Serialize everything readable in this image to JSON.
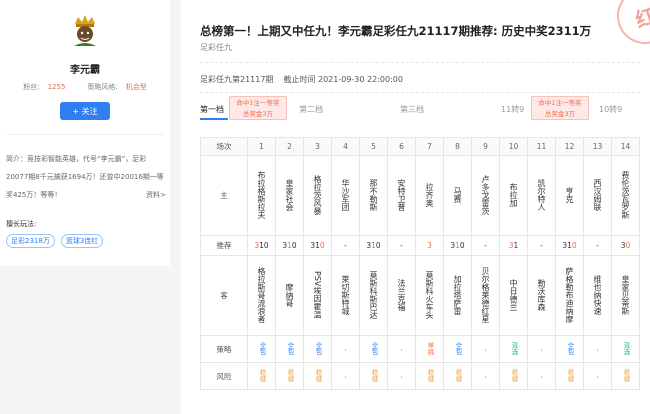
{
  "profile": {
    "name": "李元霸",
    "stats": [
      {
        "label": "粉丝:",
        "value": "1255"
      },
      {
        "label": "策略风格:",
        "value": "机会型"
      }
    ],
    "follow_label": "+ 关注",
    "intro": "简介：竞技彩智能英雄，代号“李元霸”，足彩20077期8千元擒获1694万！还曾中20016期一等奖425万！等等！",
    "more_label": "资料>",
    "good_at_label": "擅长玩法:",
    "tags": [
      "足彩2318万",
      "篮球3连红"
    ]
  },
  "article": {
    "title": "总榜第一！上期又中任九！李元霸足彩任九21117期推荐: 历史中奖2311万",
    "subtitle": "足彩任九",
    "stamp": "红",
    "period": "足彩任九第21117期",
    "deadline": "截止时间 2021-09-30 22:00:00"
  },
  "tiers": [
    {
      "label": "第一档"
    },
    {
      "label": "第二档"
    },
    {
      "label": "第三档"
    },
    {
      "label": "11转9"
    },
    {
      "label": "10转9"
    }
  ],
  "badges": [
    {
      "line1": "命中1注一等奖",
      "line2": "总奖金3万"
    },
    {
      "line1": "命中1注一等奖",
      "line2": "总奖金3万"
    }
  ],
  "table": {
    "row_labels": {
      "index": "场次",
      "home": "主",
      "rec": "推荐",
      "away": "客",
      "strategy": "策略",
      "risk": "风险"
    },
    "matches": [
      {
        "no": "1",
        "home": "布拉格斯拉夫",
        "rec": [
          "3",
          "1",
          "0"
        ],
        "hits": [
          true,
          false,
          false
        ],
        "away": "格拉斯哥流浪者",
        "strategy": "全包",
        "risk": "稳健"
      },
      {
        "no": "2",
        "home": "皇家社会",
        "rec": [
          "3",
          "1",
          "0"
        ],
        "hits": [
          false,
          true,
          false
        ],
        "away": "摩纳哥",
        "strategy": "全包",
        "risk": "稳健"
      },
      {
        "no": "3",
        "home": "格拉茨风暴",
        "rec": [
          "3",
          "1",
          "0"
        ],
        "hits": [
          false,
          false,
          true
        ],
        "away": "PSV埃因霍温",
        "strategy": "全包",
        "risk": "稳健"
      },
      {
        "no": "4",
        "home": "华沙军团",
        "rec": [
          "-"
        ],
        "hits": [
          false
        ],
        "away": "莱切斯特城",
        "strategy": "-",
        "risk": "-"
      },
      {
        "no": "5",
        "home": "那不勒斯",
        "rec": [
          "3",
          "1",
          "0"
        ],
        "hits": [
          false,
          true,
          false
        ],
        "away": "莫斯科斯巴达",
        "strategy": "全包",
        "risk": "稳健"
      },
      {
        "no": "6",
        "home": "安特卫普",
        "rec": [
          "-"
        ],
        "hits": [
          false
        ],
        "away": "法兰克福",
        "strategy": "-",
        "risk": "-"
      },
      {
        "no": "7",
        "home": "拉齐奥",
        "rec": [
          "3"
        ],
        "hits": [
          true
        ],
        "away": "莫斯科火车头",
        "strategy": "单挑",
        "risk": "稳健"
      },
      {
        "no": "8",
        "home": "马赛",
        "rec": [
          "3",
          "1",
          "0"
        ],
        "hits": [
          false,
          true,
          false
        ],
        "away": "加拉塔萨雷",
        "strategy": "全包",
        "risk": "稳健"
      },
      {
        "no": "9",
        "home": "卢多戈雷茨",
        "rec": [
          "-"
        ],
        "hits": [
          false
        ],
        "away": "贝尔格莱德红星",
        "strategy": "-",
        "risk": "-"
      },
      {
        "no": "10",
        "home": "布拉加",
        "rec": [
          "3",
          "1"
        ],
        "hits": [
          true,
          false
        ],
        "away": "中日德兰",
        "strategy": "双选",
        "risk": "稳健"
      },
      {
        "no": "11",
        "home": "凯尔特人",
        "rec": [
          "-"
        ],
        "hits": [
          false
        ],
        "away": "勒沃库森",
        "strategy": "-",
        "risk": "-"
      },
      {
        "no": "12",
        "home": "亨克",
        "rec": [
          "3",
          "1",
          "0"
        ],
        "hits": [
          false,
          false,
          true
        ],
        "away": "萨格勒布迪纳摩",
        "strategy": "全包",
        "risk": "稳健"
      },
      {
        "no": "13",
        "home": "西汉姆联",
        "rec": [
          "-"
        ],
        "hits": [
          false
        ],
        "away": "维也纳快速",
        "strategy": "-",
        "risk": "-"
      },
      {
        "no": "14",
        "home": "费伦茨瓦罗斯",
        "rec": [
          "3",
          "0"
        ],
        "hits": [
          false,
          true
        ],
        "away": "皇家贝蒂斯",
        "strategy": "双选",
        "risk": "稳健"
      }
    ]
  },
  "colors": {
    "accent": "#2f7ff2",
    "hit": "#f06d4d",
    "strategy_single": "#f06d4d",
    "strategy_double": "#2bb673",
    "risk": "#f0a04b"
  }
}
